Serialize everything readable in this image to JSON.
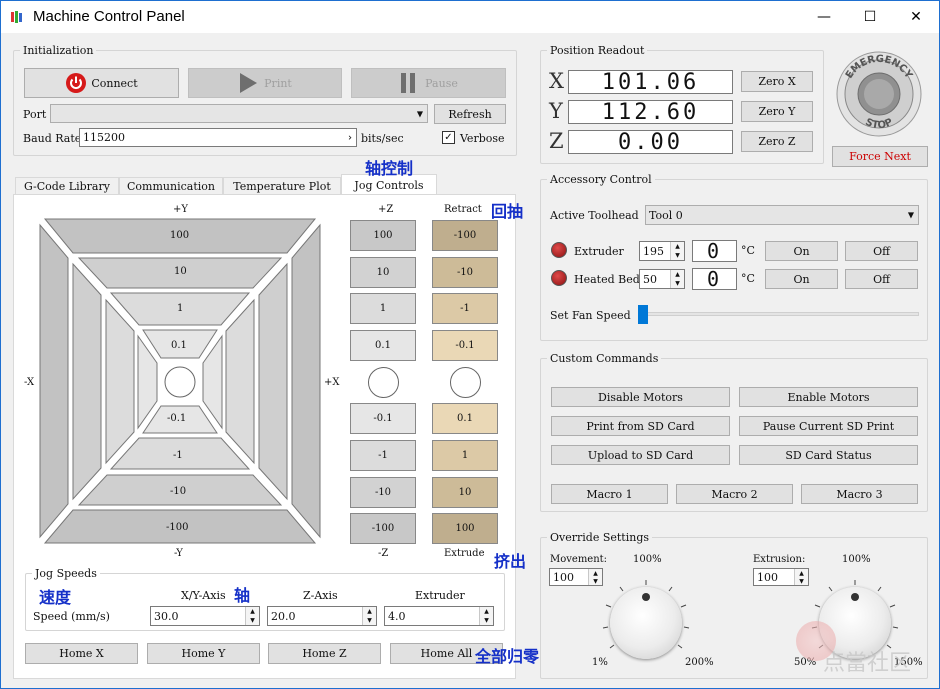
{
  "window": {
    "title": "Machine Control Panel",
    "controls": {
      "minimize": "—",
      "maximize": "☐",
      "close": "✕"
    }
  },
  "init": {
    "legend": "Initialization",
    "connect": "Connect",
    "print": "Print",
    "pause": "Pause",
    "port_label": "Port",
    "port_value": "",
    "refresh": "Refresh",
    "baud_label": "Baud Rate",
    "baud_value": "115200",
    "baud_unit": "bits/sec",
    "verbose_label": "Verbose",
    "verbose_checked": true
  },
  "tabs": [
    "G-Code Library",
    "Communication",
    "Temperature Plot",
    "Jog Controls"
  ],
  "active_tab": "Jog Controls",
  "jog": {
    "plus_y": "+Y",
    "minus_y": "-Y",
    "minus_x": "-X",
    "plus_x": "+X",
    "xy_steps_up": [
      "100",
      "10",
      "1",
      "0.1"
    ],
    "xy_steps_down": [
      "-0.1",
      "-1",
      "-10",
      "-100"
    ],
    "z_title": "+Z",
    "z_bottom": "-Z",
    "z_up": [
      "100",
      "10",
      "1",
      "0.1"
    ],
    "z_down": [
      "-0.1",
      "-1",
      "-10",
      "-100"
    ],
    "e_title": "Retract",
    "e_bottom": "Extrude",
    "e_up": [
      "-100",
      "-10",
      "-1",
      "-0.1"
    ],
    "e_down": [
      "0.1",
      "1",
      "10",
      "100"
    ]
  },
  "speeds": {
    "legend": "Jog Speeds",
    "speed_label": "Speed (mm/s)",
    "xy_label": "X/Y-Axis",
    "z_label": "Z-Axis",
    "e_label": "Extruder",
    "xy_value": "30.0",
    "z_value": "20.0",
    "e_value": "4.0"
  },
  "home": {
    "x": "Home X",
    "y": "Home Y",
    "z": "Home Z",
    "all": "Home All"
  },
  "position": {
    "legend": "Position Readout",
    "x_label": "X",
    "y_label": "Y",
    "z_label": "Z",
    "x_value": "101.06",
    "y_value": "112.60",
    "z_value": "0.00",
    "zero_x": "Zero X",
    "zero_y": "Zero Y",
    "zero_z": "Zero Z"
  },
  "emergency": {
    "top": "EMERGENCY",
    "bottom": "STOP",
    "force_next": "Force Next"
  },
  "accessory": {
    "legend": "Accessory Control",
    "toolhead_label": "Active Toolhead",
    "toolhead_value": "Tool 0",
    "extruder_label": "Extruder",
    "extruder_target": "195",
    "extruder_temp": "0",
    "bed_label": "Heated Bed",
    "bed_target": "50",
    "bed_temp": "0",
    "unit": "°C",
    "on": "On",
    "off": "Off",
    "fan_label": "Set Fan Speed",
    "fan_level": 0
  },
  "custom": {
    "legend": "Custom Commands",
    "disable_motors": "Disable Motors",
    "enable_motors": "Enable Motors",
    "print_sd": "Print from SD Card",
    "pause_sd": "Pause Current SD Print",
    "upload_sd": "Upload to SD Card",
    "sd_status": "SD Card Status",
    "macro1": "Macro 1",
    "macro2": "Macro 2",
    "macro3": "Macro 3"
  },
  "override": {
    "legend": "Override Settings",
    "movement_label": "Movement:",
    "movement_value": "100",
    "movement_pct": "100%",
    "movement_min": "1%",
    "movement_max": "200%",
    "extrusion_label": "Extrusion:",
    "extrusion_value": "100",
    "extrusion_pct": "100%",
    "extrusion_min": "50%",
    "extrusion_max": "150%"
  },
  "annotations": {
    "axis_control": "轴控制",
    "retract": "回抽",
    "extrude": "挤出",
    "speed": "速度",
    "axis": "轴",
    "home_all": "全部归零"
  },
  "watermark": {
    "text": "点當社区"
  },
  "colors": {
    "accent": "#1e6fd0",
    "force_red": "#cc0000",
    "annotation": "#1530c8",
    "stop_red": "#c01010"
  }
}
